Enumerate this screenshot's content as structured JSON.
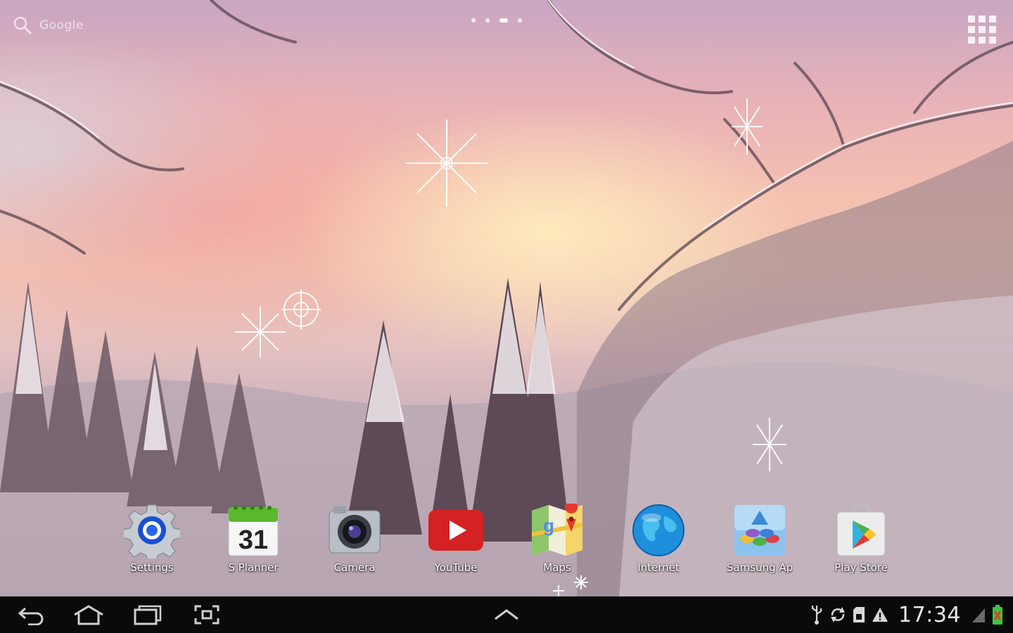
{
  "top_bar": {
    "search_label": "Google"
  },
  "dock_apps": [
    {
      "label": "Settings"
    },
    {
      "label": "S Planner",
      "date": "31"
    },
    {
      "label": "Camera"
    },
    {
      "label": "YouTube"
    },
    {
      "label": "Maps"
    },
    {
      "label": "Internet"
    },
    {
      "label": "Samsung Ap"
    },
    {
      "label": "Play Store"
    }
  ],
  "status_bar": {
    "time": "17:34"
  },
  "colors": {
    "navbar_bg": "#0a0a0a",
    "youtube_red": "#d42222",
    "calendar_green": "#5cb82e",
    "battery_green": "#3fc43f",
    "battery_warning": "#e53030"
  },
  "icons": [
    "search-icon",
    "apps-grid-icon",
    "back-icon",
    "home-icon",
    "recent-apps-icon",
    "screenshot-icon",
    "chevron-up-icon",
    "usb-icon",
    "sync-icon",
    "sd-card-icon",
    "warning-icon",
    "signal-icon",
    "battery-icon"
  ]
}
